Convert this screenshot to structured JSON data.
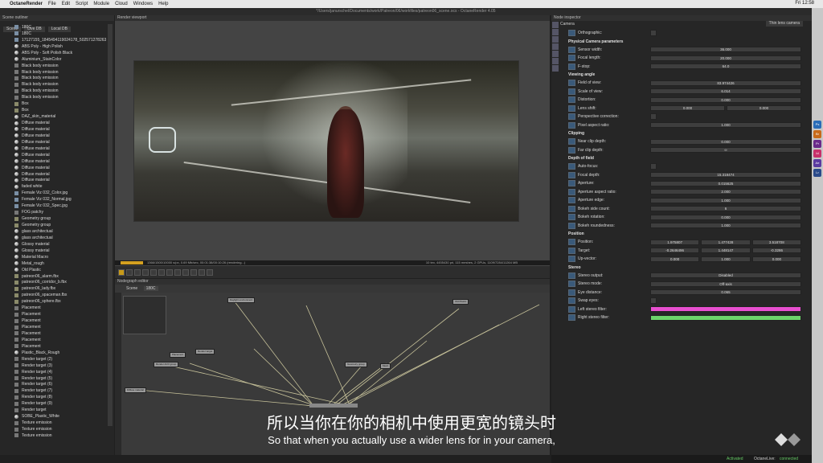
{
  "menubar": {
    "apple": "",
    "app_name": "OctaneRender",
    "items": [
      "File",
      "Edit",
      "Script",
      "Module",
      "Cloud",
      "Windows",
      "Help"
    ],
    "clock": "Fri 12:58"
  },
  "window_title": "*/Users/janurschel/Documents/work/Patreon/06/workfiles/patreon06_scene.ocs - OctaneRender 4.05",
  "outliner": {
    "title": "Scene outliner",
    "tabs": [
      "Scene",
      "Live DB",
      "Local DB"
    ],
    "items": [
      {
        "label": "180C",
        "icon": "texture"
      },
      {
        "label": "180C",
        "icon": "texture"
      },
      {
        "label": "17127155_1845494119024178_502571278263",
        "icon": "texture"
      },
      {
        "label": "ABS Poly - High Polish",
        "icon": "material"
      },
      {
        "label": "ABS Poly - Soft Polish Black",
        "icon": "material"
      },
      {
        "label": "Aluminium_StainColor",
        "icon": "material"
      },
      {
        "label": "Black body emission",
        "icon": "node"
      },
      {
        "label": "Black body emission",
        "icon": "node"
      },
      {
        "label": "Black body emission",
        "icon": "node"
      },
      {
        "label": "Black body emission",
        "icon": "node"
      },
      {
        "label": "Black body emission",
        "icon": "node"
      },
      {
        "label": "Black body emission",
        "icon": "node"
      },
      {
        "label": "Box",
        "icon": "geometry"
      },
      {
        "label": "Box",
        "icon": "geometry"
      },
      {
        "label": "DAZ_skin_material",
        "icon": "material"
      },
      {
        "label": "Diffuse material",
        "icon": "material"
      },
      {
        "label": "Diffuse material",
        "icon": "material"
      },
      {
        "label": "Diffuse material",
        "icon": "material"
      },
      {
        "label": "Diffuse material",
        "icon": "material"
      },
      {
        "label": "Diffuse material",
        "icon": "material"
      },
      {
        "label": "Diffuse material",
        "icon": "material"
      },
      {
        "label": "Diffuse material",
        "icon": "material"
      },
      {
        "label": "Diffuse material",
        "icon": "material"
      },
      {
        "label": "Diffuse material",
        "icon": "material"
      },
      {
        "label": "Diffuse material",
        "icon": "material"
      },
      {
        "label": "faded white",
        "icon": "material"
      },
      {
        "label": "Female Viz 032_Color.jpg",
        "icon": "texture"
      },
      {
        "label": "Female Viz 032_Normal.jpg",
        "icon": "texture"
      },
      {
        "label": "Female Viz 032_Spec.jpg",
        "icon": "texture"
      },
      {
        "label": "FOG patchy",
        "icon": "node"
      },
      {
        "label": "Geometry group",
        "icon": "geometry"
      },
      {
        "label": "Geometry group",
        "icon": "geometry"
      },
      {
        "label": "glass architectual",
        "icon": "material"
      },
      {
        "label": "glass architectual",
        "icon": "material"
      },
      {
        "label": "Glossy material",
        "icon": "material"
      },
      {
        "label": "Glossy material",
        "icon": "material"
      },
      {
        "label": "Material Macro",
        "icon": "material"
      },
      {
        "label": "Metal_rough",
        "icon": "material"
      },
      {
        "label": "Old Plastic",
        "icon": "material"
      },
      {
        "label": "patreon06_alarm.fbx",
        "icon": "geometry"
      },
      {
        "label": "patreon06_corridor_b.fbx",
        "icon": "geometry"
      },
      {
        "label": "patreon06_lady.fbx",
        "icon": "geometry"
      },
      {
        "label": "patreon06_spaceman.fbx",
        "icon": "geometry"
      },
      {
        "label": "patreon06_sphere.fbx",
        "icon": "geometry"
      },
      {
        "label": "Placement",
        "icon": "node"
      },
      {
        "label": "Placement",
        "icon": "node"
      },
      {
        "label": "Placement",
        "icon": "node"
      },
      {
        "label": "Placement",
        "icon": "node"
      },
      {
        "label": "Placement",
        "icon": "node"
      },
      {
        "label": "Placement",
        "icon": "node"
      },
      {
        "label": "Placement",
        "icon": "node"
      },
      {
        "label": "Plastic_Black_Rough",
        "icon": "material"
      },
      {
        "label": "Render target (2)",
        "icon": "node"
      },
      {
        "label": "Render target (3)",
        "icon": "node"
      },
      {
        "label": "Render target (4)",
        "icon": "node"
      },
      {
        "label": "Render target (5)",
        "icon": "node"
      },
      {
        "label": "Render target (6)",
        "icon": "node"
      },
      {
        "label": "Render target (7)",
        "icon": "node"
      },
      {
        "label": "Render target (8)",
        "icon": "node"
      },
      {
        "label": "Render target (9)",
        "icon": "node"
      },
      {
        "label": "Render target",
        "icon": "node"
      },
      {
        "label": "SOBE_Plastic_White",
        "icon": "material"
      },
      {
        "label": "Texture emission",
        "icon": "node"
      },
      {
        "label": "Texture emission",
        "icon": "node"
      },
      {
        "label": "Texture emission",
        "icon": "node"
      }
    ]
  },
  "viewport": {
    "title": "Render viewport",
    "status_left": "1366/1500/10000 s/px, 0.69 Mb/sec, 00:01:38/00:10:26 (rendering...)",
    "status_right": "10 tex, 4455430 pri, 115 meshes, 2 GPUs, 1109/7284/11264 MB",
    "progress": 0.14
  },
  "nodegraph": {
    "title": "Nodegraph editor",
    "tabs": [
      "Scene",
      "180C"
    ],
    "nodes": [
      "Daylight environment",
      "Render target",
      "Placement",
      "Render AOV group",
      "Geometry group",
      "Mesh",
      "Old Plastic",
      "Diffuse material"
    ]
  },
  "inspector": {
    "title": "Node inspector",
    "camera_label": "Camera",
    "camera_type": "Thin lens camera",
    "sections": [
      {
        "name": null,
        "rows": [
          {
            "label": "Orthographic:",
            "type": "check"
          }
        ]
      },
      {
        "name": "Physical Camera parameters",
        "rows": [
          {
            "label": "Sensor width:",
            "values": [
              "36.000"
            ],
            "fill": 0.6
          },
          {
            "label": "Focal length:",
            "values": [
              "20.000"
            ],
            "fill": 0.12
          },
          {
            "label": "F-stop:",
            "values": [
              "64.0"
            ],
            "fill": 0.95
          }
        ]
      },
      {
        "name": "Viewing angle",
        "rows": [
          {
            "label": "Field of view:",
            "values": [
              "83.974426"
            ],
            "fill": 0.55
          },
          {
            "label": "Scale of view:",
            "values": [
              "6.014"
            ],
            "fill": 0.05
          },
          {
            "label": "Distortion:",
            "values": [
              "0.000"
            ],
            "fill": 0
          },
          {
            "label": "Lens shift:",
            "values": [
              "0.000",
              "0.000"
            ],
            "fill": 0
          },
          {
            "label": "Perspective correction:",
            "type": "check"
          },
          {
            "label": "Pixel aspect ratio:",
            "values": [
              "1.000"
            ],
            "fill": 0.1
          }
        ]
      },
      {
        "name": "Clipping",
        "rows": [
          {
            "label": "Near clip depth:",
            "values": [
              "0.000"
            ],
            "fill": 0
          },
          {
            "label": "Far clip depth:",
            "values": [
              "∞"
            ],
            "fill": 0
          }
        ]
      },
      {
        "name": "Depth of field",
        "rows": [
          {
            "label": "Auto-focus:",
            "type": "check"
          },
          {
            "label": "Focal depth:",
            "values": [
              "15.318474"
            ],
            "fill": 0.25
          },
          {
            "label": "Aperture:",
            "values": [
              "0.015625"
            ],
            "fill": 0.02
          },
          {
            "label": "Aperture aspect ratio:",
            "values": [
              "2.000"
            ],
            "fill": 0.4
          },
          {
            "label": "Aperture edge:",
            "values": [
              "1.000"
            ],
            "fill": 0.2
          },
          {
            "label": "Bokeh side count:",
            "values": [
              "6"
            ],
            "fill": 0.5
          },
          {
            "label": "Bokeh rotation:",
            "values": [
              "0.000"
            ],
            "fill": 0
          },
          {
            "label": "Bokeh roundedness:",
            "values": [
              "1.000"
            ],
            "fill": 0.2
          }
        ]
      },
      {
        "name": "Position",
        "rows": [
          {
            "label": "Position:",
            "values": [
              "1.975807",
              "1.477428",
              "3.518708"
            ],
            "fill": 0
          },
          {
            "label": "Target:",
            "values": [
              "-0.2646496",
              "1.448147",
              "-0.3286"
            ],
            "fill": 0
          },
          {
            "label": "Up-vector:",
            "values": [
              "0.000",
              "1.000",
              "0.000"
            ],
            "fill": 0
          }
        ]
      },
      {
        "name": "Stereo",
        "rows": [
          {
            "label": "Stereo output:",
            "values": [
              "Disabled"
            ],
            "type": "select"
          },
          {
            "label": "Stereo mode:",
            "values": [
              "Off-axis"
            ],
            "type": "select"
          },
          {
            "label": "Eye distance:",
            "values": [
              "0.065"
            ],
            "fill": 0.1
          },
          {
            "label": "Swap eyes:",
            "type": "check"
          },
          {
            "label": "Left stereo filter:",
            "type": "color",
            "color": "#e84fd0"
          },
          {
            "label": "Right stereo filter:",
            "type": "color",
            "color": "#6cd46a"
          }
        ]
      }
    ]
  },
  "footer": {
    "activated": "Activated",
    "live": "OctaneLive:",
    "live_status": "connected"
  },
  "subtitles": {
    "cn": "所以当你在你的相机中使用更宽的镜头时",
    "en": "So that when you actually use a wider lens for in your camera,"
  },
  "dock": {
    "items": [
      "Ps",
      "Br",
      "Pr",
      "Id",
      "Ae",
      "Lr"
    ]
  },
  "colors": {
    "accent": "#d4a020",
    "left_filter": "#e84fd0",
    "right_filter": "#6cd46a"
  }
}
